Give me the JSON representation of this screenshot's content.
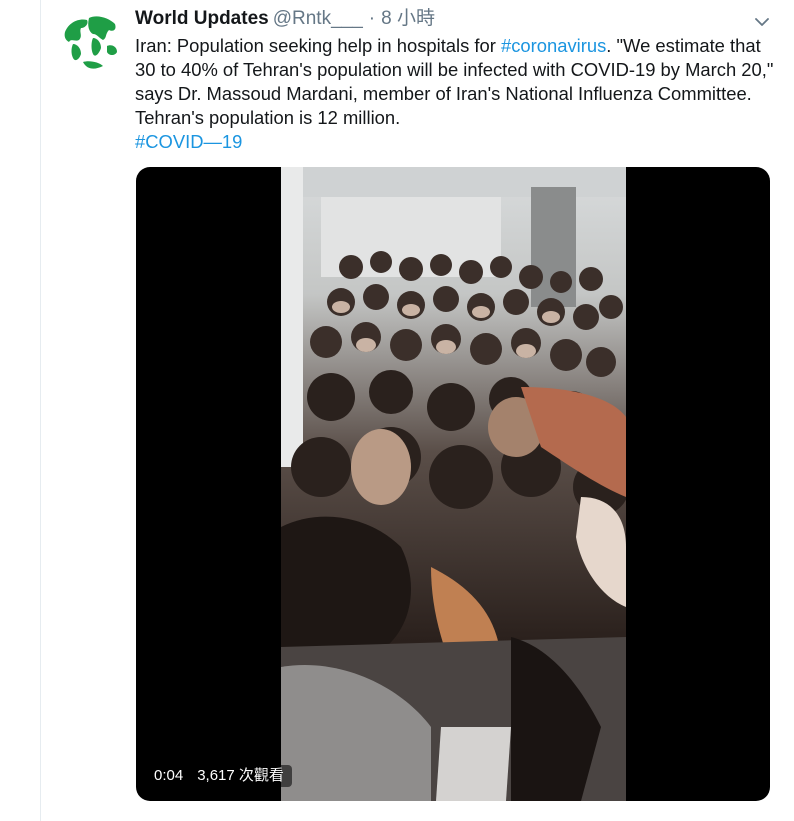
{
  "tweet": {
    "display_name": "World Updates",
    "handle": "@Rntk___",
    "separator": "·",
    "time": "8 小時",
    "text_parts": [
      "Iran: Population seeking help in hospitals for ",
      "#coronavirus",
      ". \"We estimate that 30 to 40% of Tehran's population will be infected with COVID-19 by March 20,\" says Dr. Massoud Mardani, member of Iran's National Influenza Committee. Tehran's population is 12 million.",
      "#COVID—19"
    ]
  },
  "video": {
    "duration": "0:04",
    "views": "3,617 次觀看"
  },
  "icons": {
    "avatar": "globe-map-icon",
    "menu": "chevron-down-icon"
  },
  "colors": {
    "link": "#1b95e0",
    "text": "#14171a",
    "secondary": "#657786",
    "avatar_green": "#1f9e46"
  }
}
